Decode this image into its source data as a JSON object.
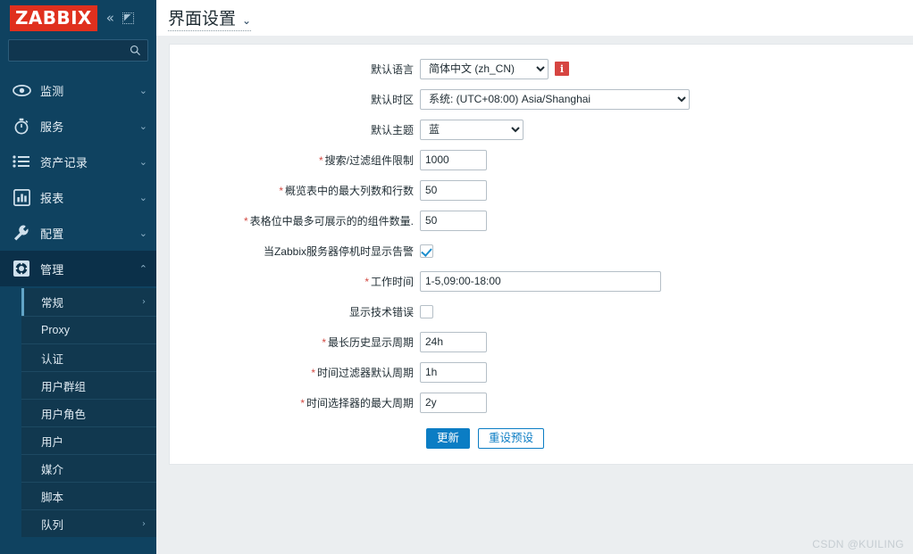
{
  "brand": {
    "logo_text": "ZABBIX"
  },
  "sidebar": {
    "collapse_icon": "«",
    "search": {
      "value": "",
      "placeholder": ""
    },
    "nav": [
      {
        "label": "监测",
        "icon": "eye-icon",
        "chevron": "⌄"
      },
      {
        "label": "服务",
        "icon": "clock-icon",
        "chevron": "⌄"
      },
      {
        "label": "资产记录",
        "icon": "list-icon",
        "chevron": "⌄"
      },
      {
        "label": "报表",
        "icon": "chart-bar-icon",
        "chevron": "⌄"
      },
      {
        "label": "配置",
        "icon": "wrench-icon",
        "chevron": "⌄"
      },
      {
        "label": "管理",
        "icon": "gear-icon",
        "chevron": "⌃"
      }
    ],
    "submenu": [
      {
        "label": "常规",
        "arrow": "›",
        "active": true
      },
      {
        "label": "Proxy",
        "arrow": "",
        "active": false
      },
      {
        "label": "认证",
        "arrow": "",
        "active": false
      },
      {
        "label": "用户群组",
        "arrow": "",
        "active": false
      },
      {
        "label": "用户角色",
        "arrow": "",
        "active": false
      },
      {
        "label": "用户",
        "arrow": "",
        "active": false
      },
      {
        "label": "媒介",
        "arrow": "",
        "active": false
      },
      {
        "label": "脚本",
        "arrow": "",
        "active": false
      },
      {
        "label": "队列",
        "arrow": "›",
        "active": false
      }
    ]
  },
  "header": {
    "title": "界面设置",
    "chevron": "⌄"
  },
  "form": {
    "language": {
      "label": "默认语言",
      "value": "简体中文 (zh_CN)",
      "info_icon": "i"
    },
    "timezone": {
      "label": "默认时区",
      "value": "系统: (UTC+08:00) Asia/Shanghai"
    },
    "theme": {
      "label": "默认主题",
      "value": "蓝"
    },
    "search_limit": {
      "label": "搜索/过滤组件限制",
      "value": "1000",
      "required": "*"
    },
    "max_overview": {
      "label": "概览表中的最大列数和行数",
      "value": "50",
      "required": "*"
    },
    "max_cell": {
      "label": "表格位中最多可展示的的组件数量.",
      "value": "50",
      "required": "*"
    },
    "server_down": {
      "label": "当Zabbix服务器停机时显示告警",
      "checked": true
    },
    "working_time": {
      "label": "工作时间",
      "value": "1-5,09:00-18:00",
      "required": "*"
    },
    "tech_errors": {
      "label": "显示技术错误",
      "checked": false
    },
    "max_history": {
      "label": "最长历史显示周期",
      "value": "24h",
      "required": "*"
    },
    "time_default": {
      "label": "时间过滤器默认周期",
      "value": "1h",
      "required": "*"
    },
    "time_max": {
      "label": "时间选择器的最大周期",
      "value": "2y",
      "required": "*"
    }
  },
  "buttons": {
    "update": "更新",
    "reset": "重设预设"
  },
  "watermark": "CSDN @KUILING"
}
